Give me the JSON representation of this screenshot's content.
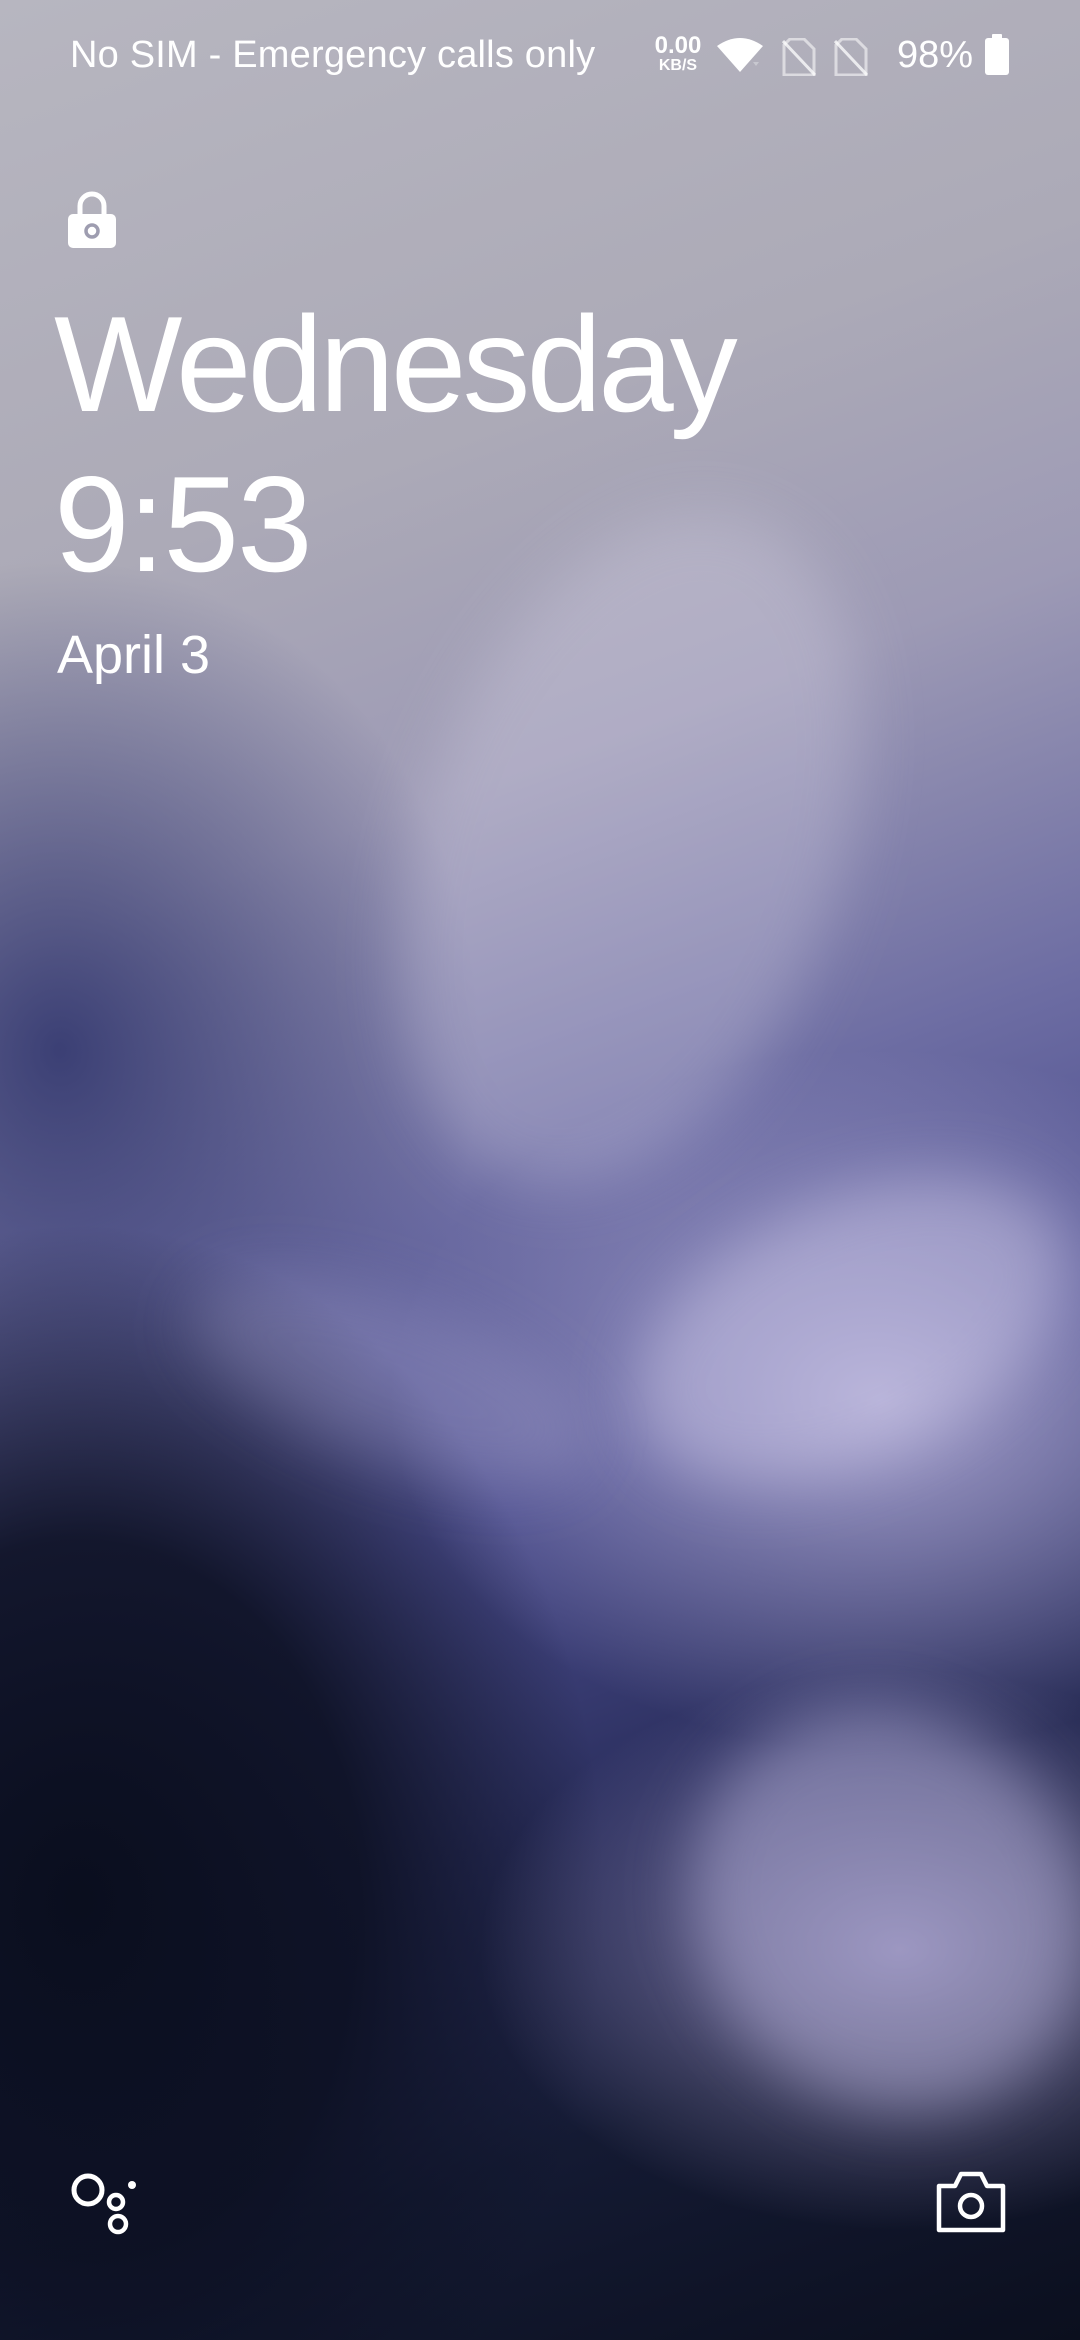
{
  "status_bar": {
    "carrier_text": "No SIM - Emergency calls only",
    "net_speed_value": "0.00",
    "net_speed_unit": "KB/S",
    "battery_percent": "98%",
    "icons": [
      "wifi-icon",
      "no-sim-icon",
      "no-sim-icon",
      "battery-icon"
    ]
  },
  "lockscreen": {
    "day": "Wednesday",
    "time": "9:53",
    "date": "April 3",
    "lock_icon": "lock-icon"
  },
  "shortcuts": {
    "left_icon": "google-assistant-icon",
    "right_icon": "camera-icon"
  },
  "colors": {
    "text": "#ffffff",
    "wallpaper_top": "#b7b6c0",
    "wallpaper_mid": "#4a4c8c",
    "wallpaper_bottom": "#0b0f1e"
  }
}
